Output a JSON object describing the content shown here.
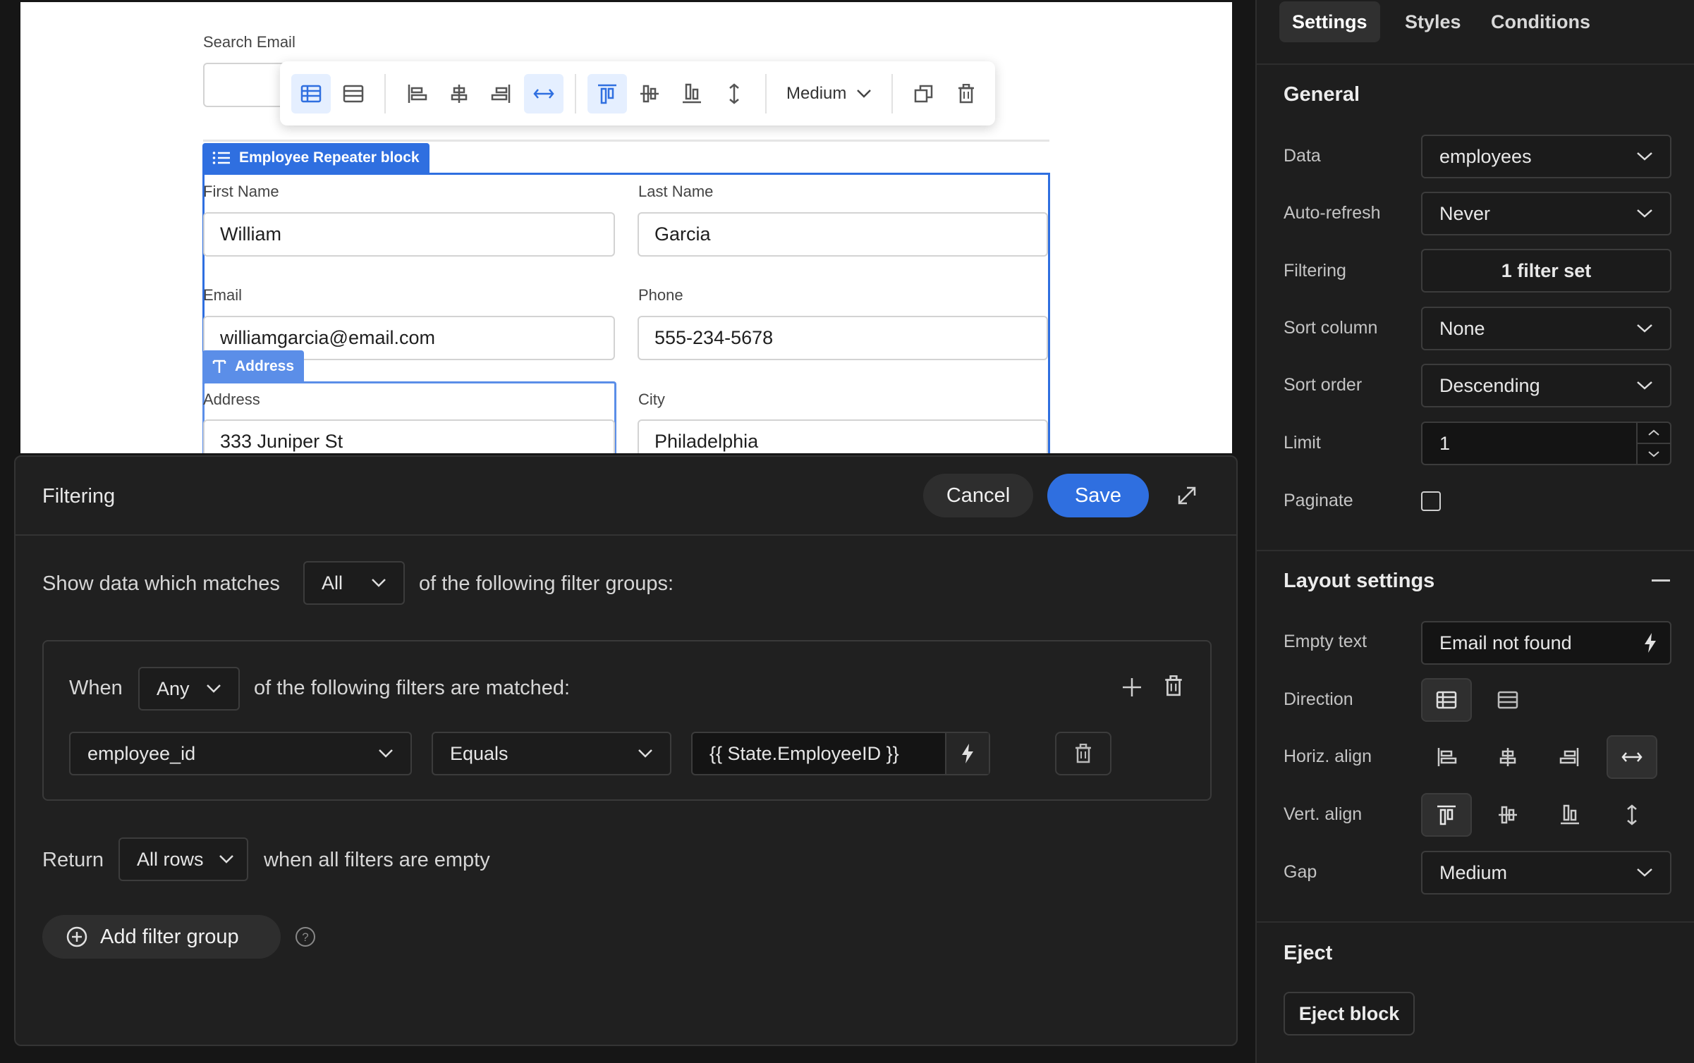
{
  "canvas": {
    "search_email_label": "Search Email",
    "toolbar": {
      "gap_label": "Medium"
    },
    "repeater_badge": "Employee Repeater block",
    "address_badge": "Address",
    "fields": [
      {
        "label": "First Name",
        "value": "William"
      },
      {
        "label": "Last Name",
        "value": "Garcia"
      },
      {
        "label": "Email",
        "value": "williamgarcia@email.com"
      },
      {
        "label": "Phone",
        "value": "555-234-5678"
      },
      {
        "label": "Address",
        "value": "333 Juniper St"
      },
      {
        "label": "City",
        "value": "Philadelphia"
      }
    ]
  },
  "filtering": {
    "title": "Filtering",
    "cancel_label": "Cancel",
    "save_label": "Save",
    "match_prefix": "Show data which matches",
    "match_value": "All",
    "match_suffix": "of the following filter groups:",
    "group": {
      "when_label": "When",
      "when_value": "Any",
      "when_suffix": "of the following filters are matched:",
      "filter": {
        "field": "employee_id",
        "operator": "Equals",
        "value": "{{ State.EmployeeID }}"
      }
    },
    "return_label": "Return",
    "return_value": "All rows",
    "return_suffix": "when all filters are empty",
    "add_group_label": "Add filter group"
  },
  "settings": {
    "tabs": [
      "Settings",
      "Styles",
      "Conditions"
    ],
    "active_tab": "Settings",
    "general": {
      "title": "General",
      "data_label": "Data",
      "data_value": "employees",
      "autorefresh_label": "Auto-refresh",
      "autorefresh_value": "Never",
      "filtering_label": "Filtering",
      "filtering_value": "1 filter set",
      "sortcol_label": "Sort column",
      "sortcol_value": "None",
      "sortorder_label": "Sort order",
      "sortorder_value": "Descending",
      "limit_label": "Limit",
      "limit_value": "1",
      "paginate_label": "Paginate"
    },
    "layout": {
      "title": "Layout settings",
      "empty_label": "Empty text",
      "empty_value": "Email not found",
      "direction_label": "Direction",
      "halign_label": "Horiz. align",
      "valign_label": "Vert. align",
      "gap_label": "Gap",
      "gap_value": "Medium"
    },
    "eject": {
      "title": "Eject",
      "button_label": "Eject block"
    }
  },
  "colors": {
    "accent": "#2f6fe0",
    "badge_light": "#5b8ee8",
    "dark_bg": "#202020"
  }
}
